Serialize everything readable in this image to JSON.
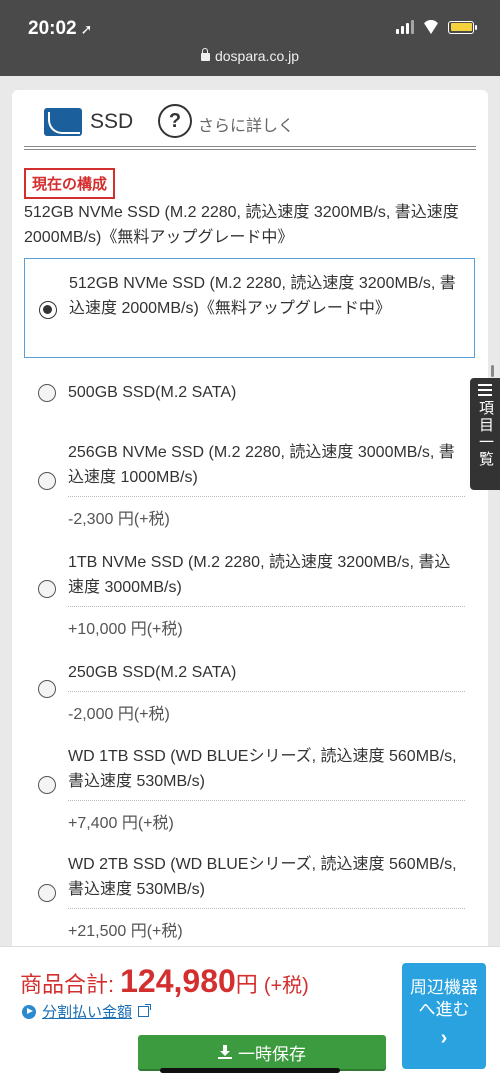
{
  "status_bar": {
    "time": "20:02",
    "location_glyph": "➚",
    "url": "dospara.co.jp"
  },
  "header": {
    "title": "SSD",
    "help_label": "さらに詳しく"
  },
  "current": {
    "badge": "現在の構成",
    "description": "512GB NVMe SSD (M.2 2280, 読込速度 3200MB/s, 書込速度 2000MB/s)《無料アップグレード中》"
  },
  "options": [
    {
      "name": "512GB NVMe SSD (M.2 2280, 読込速度 3200MB/s, 書込速度 2000MB/s)《無料アップグレード中》",
      "price": "",
      "selected": true
    },
    {
      "name": "500GB SSD(M.2 SATA)",
      "price": "",
      "selected": false
    },
    {
      "name": "256GB NVMe SSD (M.2 2280, 読込速度 3000MB/s, 書込速度 1000MB/s)",
      "price": "-2,300 円(+税)",
      "selected": false
    },
    {
      "name": "1TB NVMe SSD (M.2 2280, 読込速度 3200MB/s, 書込速度 3000MB/s)",
      "price": "+10,000 円(+税)",
      "selected": false
    },
    {
      "name": "250GB SSD(M.2 SATA)",
      "price": "-2,000 円(+税)",
      "selected": false
    },
    {
      "name": "WD 1TB SSD (WD BLUEシリーズ, 読込速度 560MB/s, 書込速度 530MB/s)",
      "price": "+7,400 円(+税)",
      "selected": false
    },
    {
      "name": "WD 2TB SSD (WD BLUEシリーズ, 読込速度 560MB/s, 書込速度 530MB/s)",
      "price": "+21,500 円(+税)",
      "selected": false
    }
  ],
  "side_tab": {
    "label": "項目一覧"
  },
  "footer": {
    "total_label": "商品合計:",
    "total_amount": "124,980",
    "total_unit": "円",
    "total_tax": "(+税)",
    "installment_label": "分割払い金額",
    "save_label": "一時保存",
    "next_label_line1": "周辺機器",
    "next_label_line2": "へ進む",
    "next_chevron": "›"
  },
  "colors": {
    "accent_red": "#d32f2f",
    "link_blue": "#1b6fb5",
    "save_green": "#3b9b3e",
    "next_blue": "#2aa2e0",
    "statusbar_gray": "#4a4a4a"
  }
}
